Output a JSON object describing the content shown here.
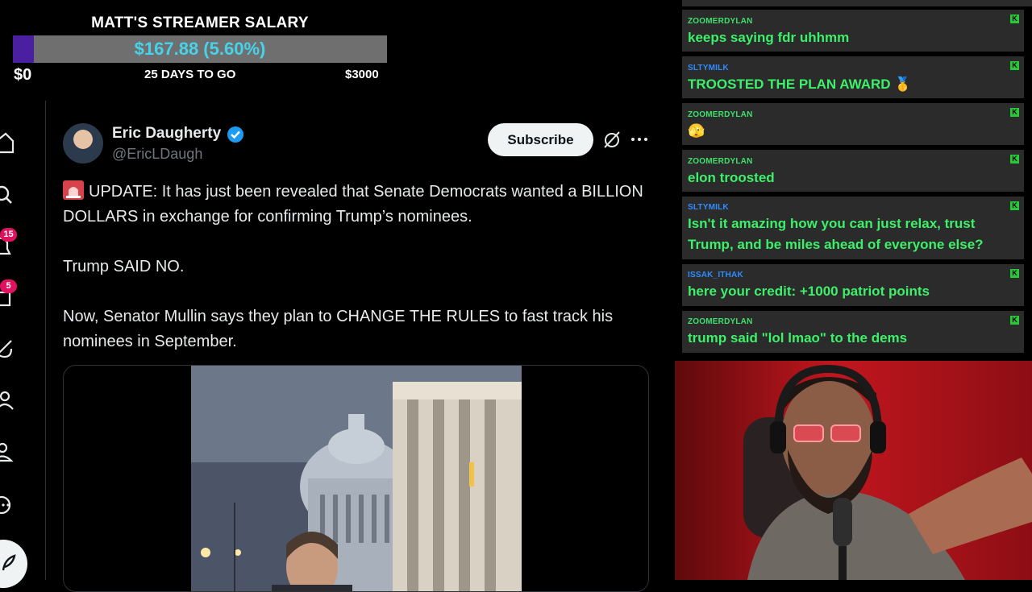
{
  "salary": {
    "title": "MATT'S STREAMER SALARY",
    "amount": "$167.88 (5.60%)",
    "progress": 0.056,
    "min": "$0",
    "days": "25 DAYS TO GO",
    "max": "$3000",
    "fill_color": "#4a1fa0",
    "amount_color": "#46d3ea"
  },
  "nav": {
    "items": [
      "home-icon",
      "search-icon",
      "notifications-icon",
      "messages-icon",
      "grok-icon",
      "communities-icon",
      "profile-icon",
      "more-icon"
    ],
    "notification_badge": "15",
    "message_badge": "5",
    "badge_color": "#e0115f"
  },
  "tweet": {
    "author_name": "Eric Daugherty",
    "author_handle": "@EricLDaugh",
    "subscribe_label": "Subscribe",
    "paragraph1": "UPDATE: It has just been revealed that Senate Democrats wanted a BILLION DOLLARS in exchange for confirming Trump’s nominees.",
    "paragraph2": "Trump SAID NO.",
    "paragraph3": "Now, Senator Mullin says they plan to CHANGE THE RULES to fast track his nominees in September."
  },
  "chat": {
    "username_color": "#3ee06c",
    "messages": [
      {
        "user": "ZOOMERDYLAN",
        "text": "keeps saying fdr uhhmm",
        "user_color": "#3ee06c"
      },
      {
        "user": "SLTYMILK",
        "text": "TROOSTED THE PLAN AWARD 🥇",
        "user_color": "#2f8cff"
      },
      {
        "user": "ZOOMERDYLAN",
        "text": "🫣",
        "user_color": "#3ee06c"
      },
      {
        "user": "ZOOMERDYLAN",
        "text": "elon troosted",
        "user_color": "#3ee06c"
      },
      {
        "user": "SLTYMILK",
        "text": "Isn't it amazing how you can just relax, trust Trump, and be miles ahead of everyone else?",
        "user_color": "#2f8cff"
      },
      {
        "user": "ISSAK_ITHAK",
        "text": "here your credit: +1000 patriot points",
        "user_color": "#2f8cff"
      },
      {
        "user": "ZOOMERDYLAN",
        "text": "trump said \"lol lmao\" to the dems",
        "user_color": "#3ee06c"
      }
    ],
    "mod_badge": "K"
  }
}
